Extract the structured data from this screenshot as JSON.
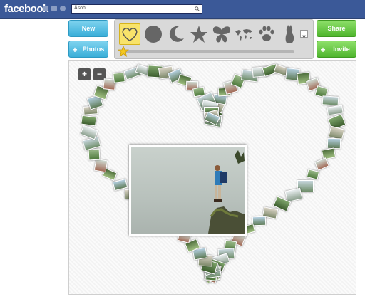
{
  "facebook": {
    "logo": "facebook",
    "search": {
      "value": "Ãsoh"
    }
  },
  "toolbar": {
    "new_label": "New",
    "photos_label": "Photos",
    "share_label": "Share",
    "invite_label": "Invite",
    "shapes": [
      "heart-icon",
      "circle-icon",
      "moon-icon",
      "star-icon",
      "butterfly-icon",
      "world-map-icon",
      "paw-icon",
      "cat-icon"
    ],
    "selected_shape": "heart-icon"
  },
  "colors": {
    "facebook_blue": "#3b5998",
    "button_blue": "#39aed8",
    "button_green": "#4fb52d",
    "selected_shape": "#f8e36a"
  },
  "canvas": {
    "zoom_in_label": "+",
    "zoom_out_label": "−"
  }
}
